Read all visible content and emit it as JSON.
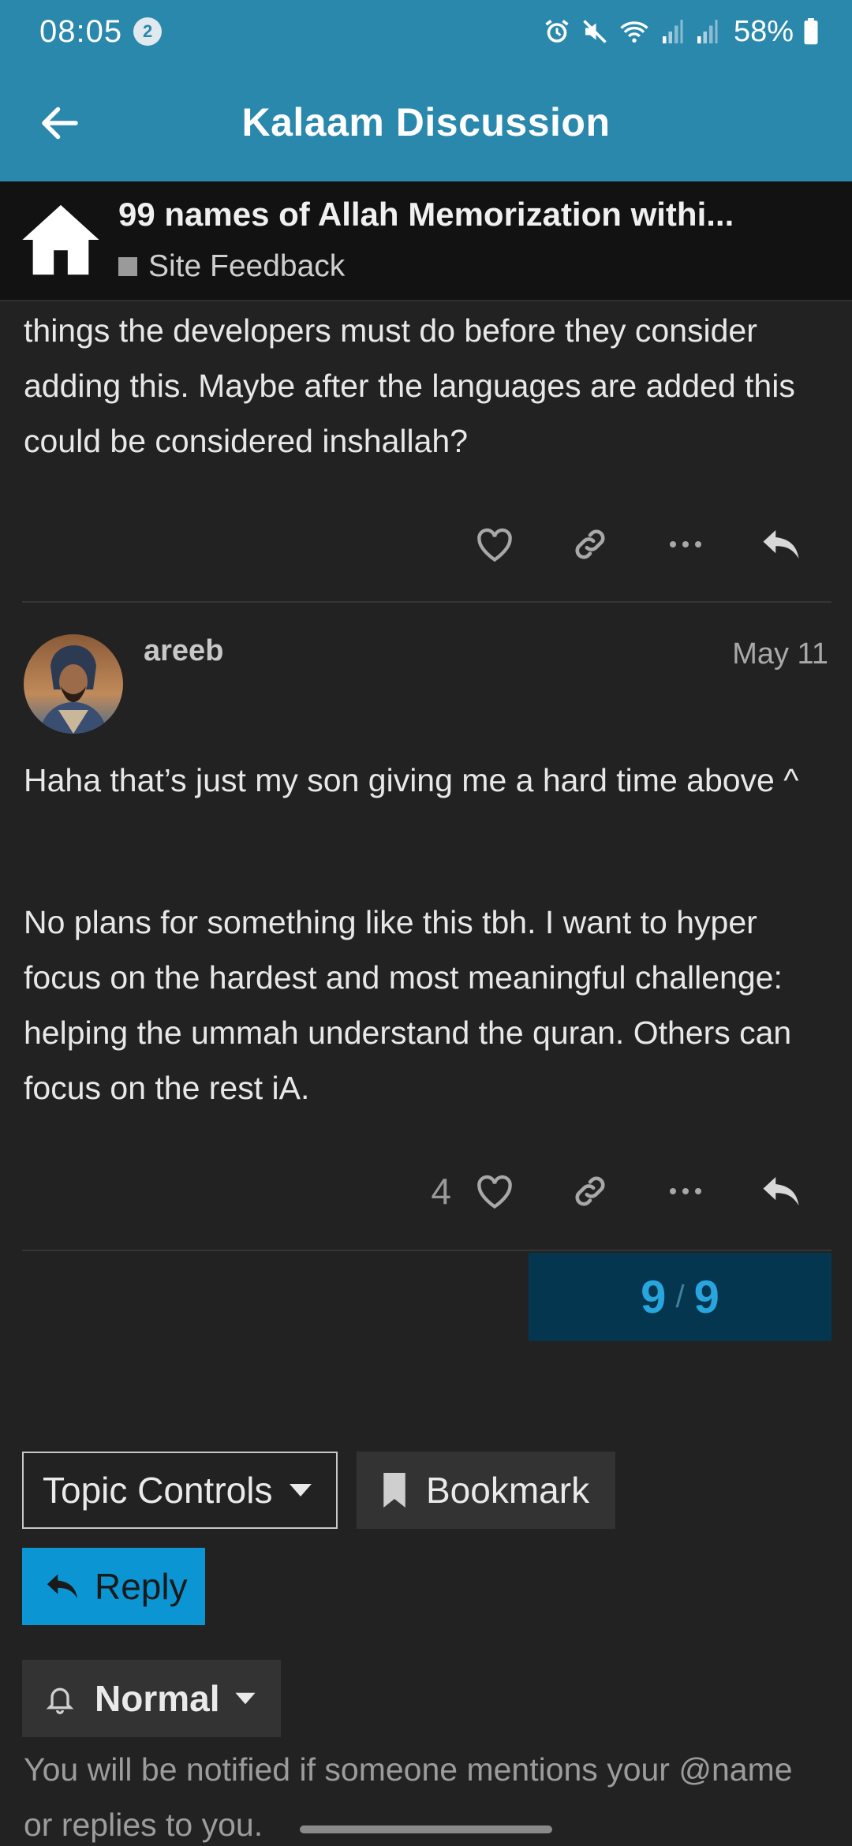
{
  "status_bar": {
    "time": "08:05",
    "notification_count": "2",
    "battery": "58%"
  },
  "header": {
    "title": "Kalaam Discussion"
  },
  "topic": {
    "title": "99 names of Allah Memorization withi...",
    "category": "Site Feedback",
    "category_color": "#9a9a9a"
  },
  "posts": [
    {
      "text": "things the developers must do before they consider adding this. Maybe after the languages are added this could be considered inshallah?",
      "likes": ""
    },
    {
      "username": "areeb",
      "date": "May 11",
      "paragraphs": [
        "Haha that’s just my son giving me a hard time above ^",
        "No plans for something like this tbh. I want to hyper focus on the hardest and most meaningful challenge: helping the ummah understand the quran. Others can focus on the rest iA."
      ],
      "likes": "4"
    }
  ],
  "progress": {
    "current": "9",
    "total": "9"
  },
  "controls": {
    "topic_controls_label": "Topic Controls",
    "bookmark_label": "Bookmark",
    "reply_label": "Reply",
    "notification_level": "Normal",
    "notification_description": "You will be notified if someone mentions your @name or replies to you."
  },
  "colors": {
    "accent": "#2a88ad",
    "reply_button": "#0c95d3",
    "progress_bg": "#053650"
  }
}
